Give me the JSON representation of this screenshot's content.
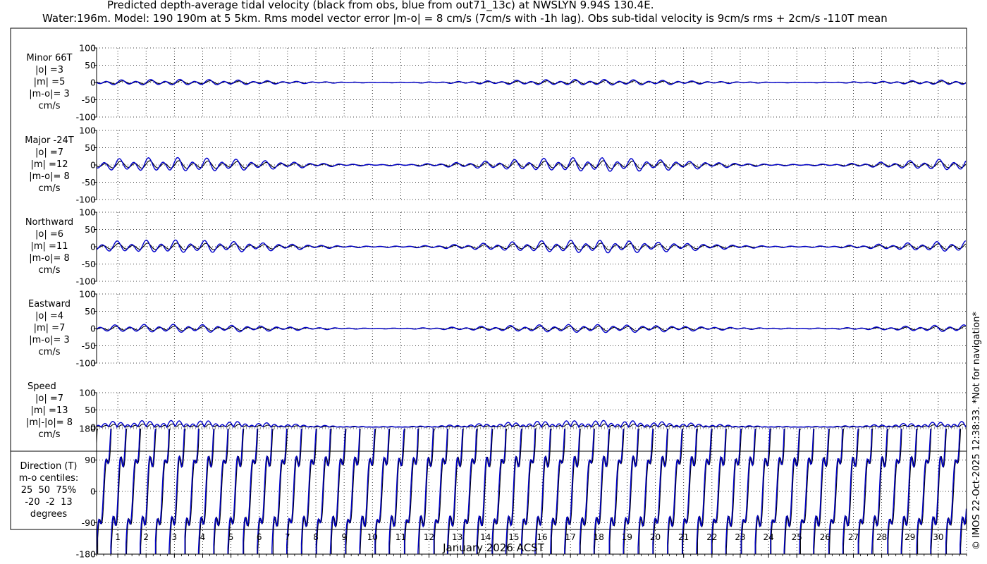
{
  "header": {
    "title_line1": "Predicted depth-average tidal velocity (black from obs, blue from out71_13c) at NWSLYN 9.94S 130.4E.",
    "title_line2": "Water:196m. Model: 190 190m at 5 5km. Rms model vector error |m-o| = 8 cm/s (7cm/s with -1h lag). Obs sub-tidal velocity is 9cm/s rms + 2cm/s -110T mean"
  },
  "credit": "© IMOS 22-Oct-2025 12:38:33. *Not for navigation*",
  "colors": {
    "obs": "#000000",
    "model": "#0000cc",
    "grid": "#000000"
  },
  "chart_data": {
    "type": "line",
    "xlabel": "January 2026 ACST",
    "x_ticks": [
      "1",
      "2",
      "3",
      "4",
      "5",
      "6",
      "7",
      "8",
      "9",
      "10",
      "11",
      "12",
      "13",
      "14",
      "15",
      "16",
      "17",
      "18",
      "19",
      "20",
      "21",
      "22",
      "23",
      "24",
      "25",
      "26",
      "27",
      "28",
      "29",
      "30"
    ],
    "x_range_days": [
      0.25,
      31.0
    ],
    "panels": [
      {
        "id": "minor",
        "label_lines": [
          "Minor 66T",
          "|o| =3",
          "|m| =5",
          "|m-o|= 3",
          "cm/s"
        ],
        "ylim": [
          -100,
          100
        ],
        "yticks": [
          "100",
          "50",
          "0",
          "-50",
          "-100"
        ],
        "obs_amplitude_cm_s": 3,
        "model_amplitude_cm_s": 5,
        "signed": true
      },
      {
        "id": "major",
        "label_lines": [
          "Major -24T",
          "|o| =7",
          "|m| =12",
          "|m-o|= 8",
          "cm/s"
        ],
        "ylim": [
          -100,
          100
        ],
        "yticks": [
          "100",
          "50",
          "0",
          "-50",
          "-100"
        ],
        "obs_amplitude_cm_s": 7,
        "model_amplitude_cm_s": 12,
        "signed": true
      },
      {
        "id": "northward",
        "label_lines": [
          "Northward",
          "|o| =6",
          "|m| =11",
          "|m-o|= 8",
          "cm/s"
        ],
        "ylim": [
          -100,
          100
        ],
        "yticks": [
          "100",
          "50",
          "0",
          "-50",
          "-100"
        ],
        "obs_amplitude_cm_s": 6,
        "model_amplitude_cm_s": 11,
        "signed": true
      },
      {
        "id": "eastward",
        "label_lines": [
          "Eastward",
          "|o| =4",
          "|m| =7",
          "|m-o|= 3",
          "cm/s"
        ],
        "ylim": [
          -100,
          100
        ],
        "yticks": [
          "100",
          "50",
          "0",
          "-50",
          "-100"
        ],
        "obs_amplitude_cm_s": 4,
        "model_amplitude_cm_s": 7,
        "signed": true
      },
      {
        "id": "speed",
        "label_lines": [
          "Speed",
          "|o| =7",
          "|m| =13",
          "|m|-|o|= 8",
          "cm/s"
        ],
        "ylim": [
          0,
          100
        ],
        "yticks": [
          "100",
          "50",
          "0"
        ],
        "obs_amplitude_cm_s": 7,
        "model_amplitude_cm_s": 13,
        "signed": false
      }
    ],
    "direction_panel": {
      "label_lines": [
        "Direction (T)",
        "m-o centiles:",
        "25  50  75%",
        "-20  -2  13",
        "degrees"
      ],
      "ylim": [
        -180,
        180
      ],
      "yticks": [
        "180",
        "90",
        "0",
        "-90",
        "-180"
      ]
    }
  }
}
